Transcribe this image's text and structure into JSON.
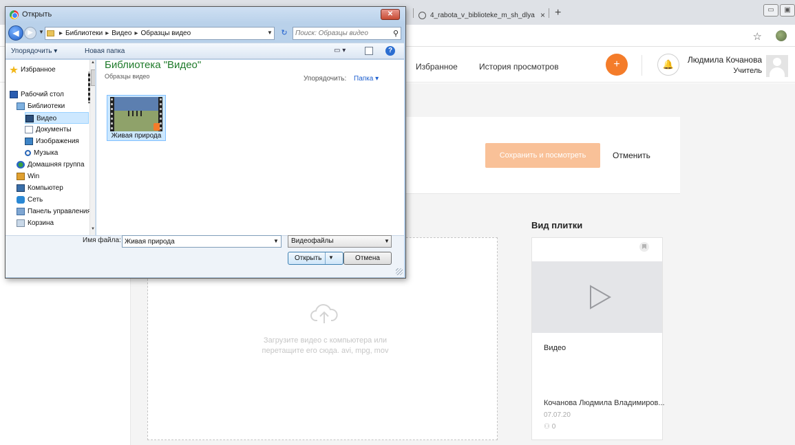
{
  "browser": {
    "tab_title": "4_rabota_v_biblioteke_m_sh_dlya",
    "tab_close": "×",
    "new_tab": "+",
    "star": "☆"
  },
  "header": {
    "nav_favorites": "Избранное",
    "nav_history": "История просмотров",
    "add_button": "+",
    "user_name": "Людмила Кочанова",
    "user_role": "Учитель"
  },
  "editor": {
    "save_button": "Сохранить и посмотреть",
    "cancel": "Отменить",
    "upload_text": "Загрузите видео с компьютера или перетащите его сюда. avi, mpg, mov",
    "tile_heading": "Вид плитки",
    "tile_title": "Видео",
    "tile_author": "Кочанова Людмила Владимиров...",
    "tile_date": "07.07.20",
    "tile_views": "0",
    "accent_color": "#f47c2a"
  },
  "dialog": {
    "title": "Открыть",
    "close": "✕",
    "breadcrumb": [
      "Библиотеки",
      "Видео",
      "Образцы видео"
    ],
    "search_placeholder": "Поиск: Образцы видео",
    "organize": "Упорядочить ▾",
    "new_folder": "Новая папка",
    "nav_items": [
      {
        "label": "Избранное",
        "icon": "star-icon"
      },
      {
        "label": "Рабочий стол",
        "icon": "desktop-icon"
      },
      {
        "label": "Библиотеки",
        "icon": "libraries-icon"
      },
      {
        "label": "Видео",
        "icon": "video-library-icon",
        "selected": true
      },
      {
        "label": "Документы",
        "icon": "documents-icon"
      },
      {
        "label": "Изображения",
        "icon": "images-icon"
      },
      {
        "label": "Музыка",
        "icon": "music-icon"
      },
      {
        "label": "Домашняя группа",
        "icon": "homegroup-icon"
      },
      {
        "label": "Win",
        "icon": "user-folder-icon"
      },
      {
        "label": "Компьютер",
        "icon": "computer-icon"
      },
      {
        "label": "Сеть",
        "icon": "network-icon"
      },
      {
        "label": "Панель управления",
        "icon": "control-panel-icon"
      },
      {
        "label": "Корзина",
        "icon": "recycle-bin-icon"
      }
    ],
    "library_title": "Библиотека \"Видео\"",
    "library_subtitle": "Образцы видео",
    "arrange_label": "Упорядочить:",
    "arrange_value": "Папка ▾",
    "file_name": "Живая природа",
    "filename_label": "Имя файла:",
    "filename_value": "Живая природа",
    "filetype_value": "Видеофайлы",
    "open_button": "Открыть",
    "cancel_button": "Отмена"
  }
}
